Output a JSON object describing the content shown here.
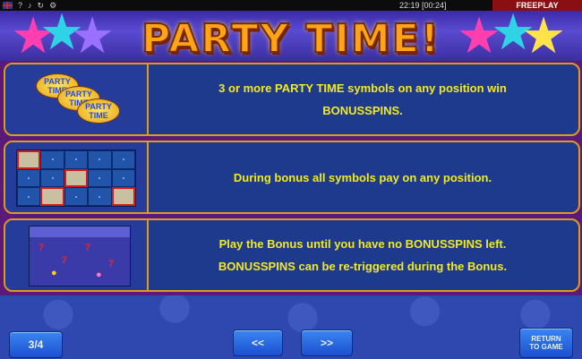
{
  "topbar": {
    "icons": [
      "uk-flag-icon",
      "help-icon",
      "sound-icon",
      "refresh-icon",
      "settings-icon"
    ],
    "icon_glyphs": [
      "?",
      "♪",
      "↻",
      "⚙"
    ],
    "clock": "22:19 [00:24]",
    "mode": "FREEPLAY"
  },
  "header": {
    "title": "PARTY TIME!"
  },
  "panels": [
    {
      "line1": "3 or more PARTY TIME symbols on any position win",
      "line2": "BONUSSPINS."
    },
    {
      "line1": "During bonus all symbols pay on any position.",
      "line2": ""
    },
    {
      "line1": "Play the Bonus until you have no BONUSSPINS left.",
      "line2": "BONUSSPINS can be re-triggered during the Bonus."
    }
  ],
  "thumbs": {
    "logo_text": "PARTY TIME"
  },
  "footer": {
    "page": "3/4",
    "prev": "<<",
    "next": ">>",
    "return_line1": "RETURN",
    "return_line2": "TO GAME"
  },
  "colors": {
    "text_yellow": "#f2ea1d",
    "panel_border": "#e29a1c",
    "freeplay_red": "#8a0f12"
  }
}
